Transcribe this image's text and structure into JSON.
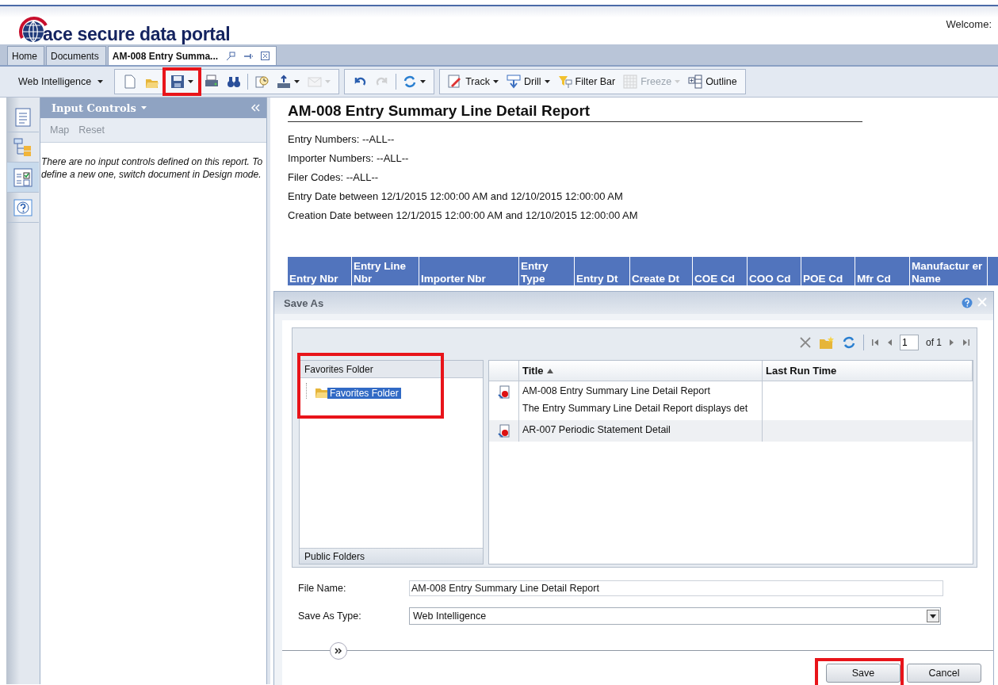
{
  "header": {
    "logo": "ace secure data portal",
    "welcome": "Welcome:"
  },
  "tabs": [
    {
      "label": "Home",
      "selected": false
    },
    {
      "label": "Documents",
      "selected": false
    },
    {
      "label": "AM-008 Entry Summa...",
      "selected": true
    }
  ],
  "toolbar": {
    "app_menu": "Web Intelligence",
    "groups": [
      [
        {
          "kind": "icon",
          "dropdown": false,
          "disabled": false,
          "highlighted": false
        },
        {
          "kind": "icon",
          "dropdown": false,
          "disabled": false,
          "highlighted": false
        },
        {
          "kind": "icon",
          "dropdown": true,
          "disabled": false,
          "highlighted": true
        },
        {
          "kind": "icon",
          "dropdown": false,
          "disabled": false,
          "highlighted": false
        },
        {
          "kind": "icon",
          "dropdown": false,
          "disabled": false,
          "highlighted": false
        },
        {
          "kind": "separator"
        },
        {
          "kind": "icon",
          "dropdown": false,
          "disabled": false,
          "highlighted": false
        },
        {
          "kind": "icon",
          "dropdown": true,
          "disabled": false,
          "highlighted": false
        },
        {
          "kind": "icon",
          "dropdown": true,
          "disabled": true,
          "highlighted": false
        }
      ],
      [
        {
          "kind": "icon",
          "dropdown": false,
          "disabled": false,
          "highlighted": false
        },
        {
          "kind": "icon",
          "dropdown": false,
          "disabled": true,
          "highlighted": false
        },
        {
          "kind": "separator"
        },
        {
          "kind": "icon",
          "dropdown": true,
          "disabled": false,
          "highlighted": false
        }
      ],
      [
        {
          "kind": "text",
          "label": "Track",
          "dropdown": true,
          "disabled": false,
          "highlighted": false
        },
        {
          "kind": "text",
          "label": "Drill",
          "dropdown": true,
          "disabled": false,
          "highlighted": false
        },
        {
          "kind": "text",
          "label": "Filter Bar",
          "dropdown": false,
          "disabled": false,
          "highlighted": false
        },
        {
          "kind": "text",
          "label": "Freeze",
          "dropdown": true,
          "disabled": true,
          "highlighted": false
        },
        {
          "kind": "text",
          "label": "Outline",
          "dropdown": false,
          "disabled": false,
          "highlighted": false
        }
      ]
    ]
  },
  "rail": [
    {
      "selected": false
    },
    {
      "selected": false
    },
    {
      "selected": true
    },
    {
      "selected": false
    }
  ],
  "input_controls": {
    "title": "Input Controls",
    "actions": [
      {
        "label": "Map",
        "disabled": true
      },
      {
        "label": "Reset",
        "disabled": true
      }
    ],
    "message": "There are no input controls defined on this report. To define a new one, switch document in Design mode."
  },
  "report": {
    "title": "AM-008 Entry Summary Line Detail Report",
    "filters": [
      "Entry Numbers: --ALL--",
      "Importer Numbers: --ALL--",
      "Filer Codes: --ALL--",
      "Entry Date between 12/1/2015 12:00:00 AM and 12/10/2015 12:00:00 AM",
      "Creation Date between 12/1/2015 12:00:00 AM and 12/10/2015 12:00:00 AM"
    ],
    "columns": [
      "Entry Nbr",
      "Entry Line Nbr",
      "Importer Nbr",
      "Entry Type",
      "Entry Dt",
      "Create Dt",
      "COE Cd",
      "COO Cd",
      "POE Cd",
      "Mfr Cd",
      "Manufactur er Name"
    ]
  },
  "dialog": {
    "title": "Save As",
    "pager": {
      "page": "1",
      "total": "of 1"
    },
    "tree": {
      "header": "Favorites Folder",
      "highlighted": true,
      "items": [
        {
          "label": "Favorites Folder",
          "selected": true
        }
      ],
      "footer": "Public Folders"
    },
    "list": {
      "columns": [
        "Title",
        "Last Run Time"
      ],
      "items": [
        {
          "title": "AM-008 Entry Summary Line Detail Report",
          "description": "The Entry Summary Line Detail Report displays det",
          "selected": false
        },
        {
          "title": "AR-007 Periodic Statement Detail",
          "selected": true
        }
      ]
    },
    "file_name": {
      "label": "File Name:",
      "value": "AM-008 Entry Summary Line Detail Report"
    },
    "save_as_type": {
      "label": "Save As Type:",
      "value": "Web Intelligence"
    },
    "buttons": [
      {
        "label": "Save",
        "highlighted": true
      },
      {
        "label": "Cancel",
        "highlighted": false
      }
    ]
  }
}
